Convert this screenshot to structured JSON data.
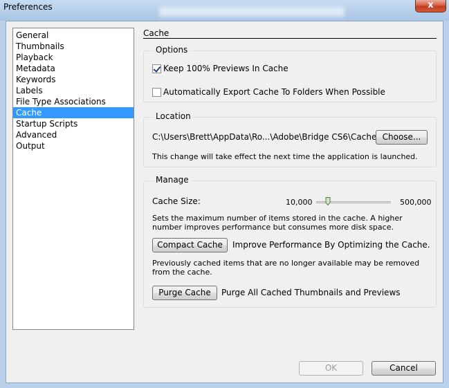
{
  "window": {
    "title": "Preferences",
    "close_symbol": "x"
  },
  "nav": {
    "items": [
      {
        "label": "General"
      },
      {
        "label": "Thumbnails"
      },
      {
        "label": "Playback"
      },
      {
        "label": "Metadata"
      },
      {
        "label": "Keywords"
      },
      {
        "label": "Labels"
      },
      {
        "label": "File Type Associations"
      },
      {
        "label": "Cache",
        "selected": true
      },
      {
        "label": "Startup Scripts"
      },
      {
        "label": "Advanced"
      },
      {
        "label": "Output"
      }
    ]
  },
  "page": {
    "title": "Cache"
  },
  "options": {
    "title": "Options",
    "keep_previews": {
      "label": "Keep 100% Previews In Cache",
      "checked": true
    },
    "auto_export": {
      "label": "Automatically Export Cache To Folders When Possible",
      "checked": false
    }
  },
  "location": {
    "title": "Location",
    "path": "C:\\Users\\Brett\\AppData\\Ro...\\Adobe\\Bridge CS6\\Cache\\",
    "choose_label": "Choose...",
    "note": "This change will take effect the next time the application is launched."
  },
  "manage": {
    "title": "Manage",
    "cache_size_label": "Cache Size:",
    "slider_min": "10,000",
    "slider_max": "500,000",
    "slider_fraction": 0.16,
    "size_desc": "Sets the maximum number of items stored in the cache. A higher number improves performance but consumes more disk space.",
    "compact_label": "Compact Cache",
    "compact_desc": "Improve Performance By Optimizing the Cache.",
    "compact_note": "Previously cached items that are no longer available may be removed from the cache.",
    "purge_label": "Purge Cache",
    "purge_desc": "Purge All Cached Thumbnails and Previews"
  },
  "footer": {
    "ok_label": "OK",
    "cancel_label": "Cancel"
  },
  "colors": {
    "selection": "#3399ff",
    "titlebar": "#b9d1ea"
  }
}
